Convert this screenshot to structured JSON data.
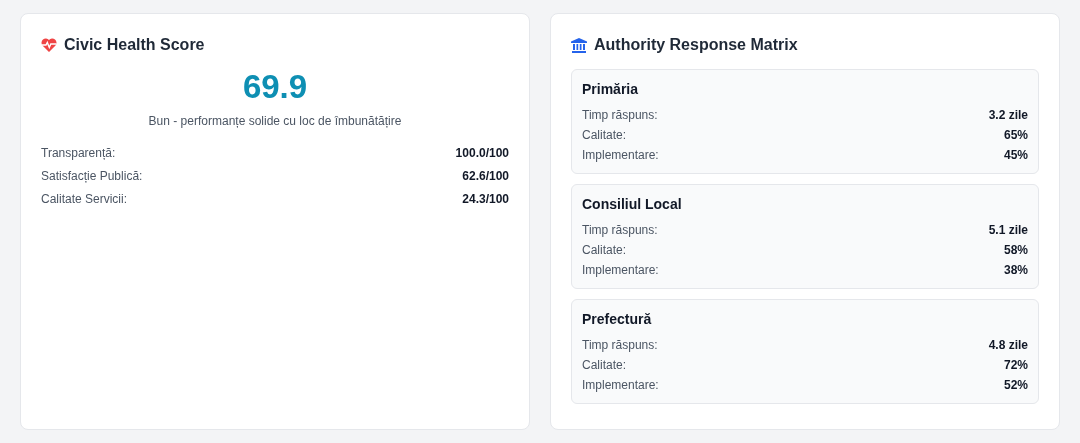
{
  "health": {
    "title": "Civic Health Score",
    "score": "69.9",
    "verdict": "Bun - performanțe solide cu loc de îmbunătățire",
    "metrics": [
      {
        "label": "Transparență:",
        "value": "100.0/100"
      },
      {
        "label": "Satisfacție Publică:",
        "value": "62.6/100"
      },
      {
        "label": "Calitate Servicii:",
        "value": "24.3/100"
      }
    ]
  },
  "matrix": {
    "title": "Authority Response Matrix",
    "authorities": [
      {
        "name": "Primăria",
        "rows": [
          {
            "label": "Timp răspuns:",
            "value": "3.2 zile"
          },
          {
            "label": "Calitate:",
            "value": "65%"
          },
          {
            "label": "Implementare:",
            "value": "45%"
          }
        ]
      },
      {
        "name": "Consiliul Local",
        "rows": [
          {
            "label": "Timp răspuns:",
            "value": "5.1 zile"
          },
          {
            "label": "Calitate:",
            "value": "58%"
          },
          {
            "label": "Implementare:",
            "value": "38%"
          }
        ]
      },
      {
        "name": "Prefectură",
        "rows": [
          {
            "label": "Timp răspuns:",
            "value": "4.8 zile"
          },
          {
            "label": "Calitate:",
            "value": "72%"
          },
          {
            "label": "Implementare:",
            "value": "52%"
          }
        ]
      }
    ]
  }
}
